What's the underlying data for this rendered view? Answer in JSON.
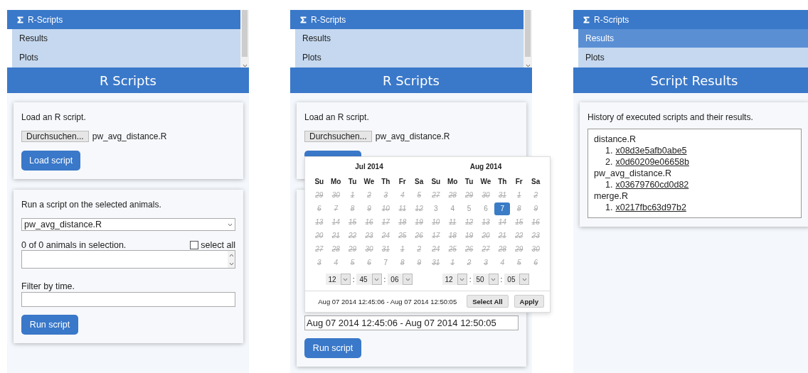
{
  "screens": [
    {
      "kind": "scripts",
      "menu": {
        "title": "R-Scripts",
        "items": [
          {
            "label": "Results",
            "selected": false
          },
          {
            "label": "Plots",
            "selected": false
          }
        ]
      },
      "title": "R Scripts",
      "load_card": {
        "text": "Load an R script.",
        "browse_button": "Durchsuchen...",
        "file_name": "pw_avg_distance.R",
        "load_button": "Load script"
      },
      "run_card": {
        "text": "Run a script on the selected animals.",
        "script_select": "pw_avg_distance.R",
        "selection_count": "0 of 0 animals in selection.",
        "select_all": {
          "label": "select all",
          "checked": false
        },
        "filter_label": "Filter by time.",
        "run_button": "Run script"
      }
    },
    {
      "kind": "scripts",
      "menu": {
        "title": "R-Scripts",
        "items": [
          {
            "label": "Results",
            "selected": false
          },
          {
            "label": "Plots",
            "selected": false
          }
        ]
      },
      "title": "R Scripts",
      "load_card": {
        "text": "Load an R script.",
        "browse_button": "Durchsuchen...",
        "file_name": "pw_avg_distance.R"
      },
      "run_card": {
        "filter_value": "Aug 07 2014 12:45:06 - Aug 07 2014 12:50:05",
        "run_button": "Run script"
      },
      "datepicker": {
        "months": [
          {
            "title": "Jul 2014",
            "weekdays": [
              "Su",
              "Mo",
              "Tu",
              "We",
              "Th",
              "Fr",
              "Sa"
            ],
            "weeks": [
              [
                {
                  "label": "29",
                  "disabled": true,
                  "selected": false
                },
                {
                  "label": "30",
                  "disabled": true,
                  "selected": false
                },
                {
                  "label": "1",
                  "disabled": true,
                  "selected": false
                },
                {
                  "label": "2",
                  "disabled": true,
                  "selected": false
                },
                {
                  "label": "3",
                  "disabled": true,
                  "selected": false
                },
                {
                  "label": "4",
                  "disabled": true,
                  "selected": false
                },
                {
                  "label": "5",
                  "disabled": true,
                  "selected": false
                }
              ],
              [
                {
                  "label": "6",
                  "disabled": true,
                  "selected": false
                },
                {
                  "label": "7",
                  "disabled": true,
                  "selected": false
                },
                {
                  "label": "8",
                  "disabled": true,
                  "selected": false
                },
                {
                  "label": "9",
                  "disabled": true,
                  "selected": false
                },
                {
                  "label": "10",
                  "disabled": true,
                  "selected": false
                },
                {
                  "label": "11",
                  "disabled": true,
                  "selected": false
                },
                {
                  "label": "12",
                  "disabled": true,
                  "selected": false
                }
              ],
              [
                {
                  "label": "13",
                  "disabled": true,
                  "selected": false
                },
                {
                  "label": "14",
                  "disabled": true,
                  "selected": false
                },
                {
                  "label": "15",
                  "disabled": true,
                  "selected": false
                },
                {
                  "label": "16",
                  "disabled": true,
                  "selected": false
                },
                {
                  "label": "17",
                  "disabled": true,
                  "selected": false
                },
                {
                  "label": "18",
                  "disabled": true,
                  "selected": false
                },
                {
                  "label": "19",
                  "disabled": true,
                  "selected": false
                }
              ],
              [
                {
                  "label": "20",
                  "disabled": true,
                  "selected": false
                },
                {
                  "label": "21",
                  "disabled": true,
                  "selected": false
                },
                {
                  "label": "22",
                  "disabled": true,
                  "selected": false
                },
                {
                  "label": "23",
                  "disabled": true,
                  "selected": false
                },
                {
                  "label": "24",
                  "disabled": true,
                  "selected": false
                },
                {
                  "label": "25",
                  "disabled": true,
                  "selected": false
                },
                {
                  "label": "26",
                  "disabled": true,
                  "selected": false
                }
              ],
              [
                {
                  "label": "27",
                  "disabled": true,
                  "selected": false
                },
                {
                  "label": "28",
                  "disabled": true,
                  "selected": false
                },
                {
                  "label": "29",
                  "disabled": true,
                  "selected": false
                },
                {
                  "label": "30",
                  "disabled": true,
                  "selected": false
                },
                {
                  "label": "31",
                  "disabled": true,
                  "selected": false
                },
                {
                  "label": "1",
                  "disabled": true,
                  "selected": false
                },
                {
                  "label": "2",
                  "disabled": true,
                  "selected": false
                }
              ],
              [
                {
                  "label": "3",
                  "disabled": true,
                  "selected": false
                },
                {
                  "label": "4",
                  "disabled": true,
                  "selected": false
                },
                {
                  "label": "5",
                  "disabled": true,
                  "selected": false
                },
                {
                  "label": "6",
                  "disabled": true,
                  "selected": false
                },
                {
                  "label": "7",
                  "disabled": false,
                  "selected": false
                },
                {
                  "label": "8",
                  "disabled": true,
                  "selected": false
                },
                {
                  "label": "9",
                  "disabled": true,
                  "selected": false
                }
              ]
            ],
            "time": [
              "12",
              "45",
              "06"
            ]
          },
          {
            "title": "Aug 2014",
            "weekdays": [
              "Su",
              "Mo",
              "Tu",
              "We",
              "Th",
              "Fr",
              "Sa"
            ],
            "weeks": [
              [
                {
                  "label": "27",
                  "disabled": true,
                  "selected": false
                },
                {
                  "label": "28",
                  "disabled": true,
                  "selected": false
                },
                {
                  "label": "29",
                  "disabled": true,
                  "selected": false
                },
                {
                  "label": "30",
                  "disabled": true,
                  "selected": false
                },
                {
                  "label": "31",
                  "disabled": true,
                  "selected": false
                },
                {
                  "label": "1",
                  "disabled": true,
                  "selected": false
                },
                {
                  "label": "2",
                  "disabled": true,
                  "selected": false
                }
              ],
              [
                {
                  "label": "3",
                  "disabled": false,
                  "selected": false
                },
                {
                  "label": "4",
                  "disabled": false,
                  "selected": false
                },
                {
                  "label": "5",
                  "disabled": false,
                  "selected": false
                },
                {
                  "label": "6",
                  "disabled": false,
                  "selected": false
                },
                {
                  "label": "7",
                  "disabled": false,
                  "selected": true
                },
                {
                  "label": "8",
                  "disabled": true,
                  "selected": false
                },
                {
                  "label": "9",
                  "disabled": true,
                  "selected": false
                }
              ],
              [
                {
                  "label": "10",
                  "disabled": true,
                  "selected": false
                },
                {
                  "label": "11",
                  "disabled": true,
                  "selected": false
                },
                {
                  "label": "12",
                  "disabled": true,
                  "selected": false
                },
                {
                  "label": "13",
                  "disabled": true,
                  "selected": false
                },
                {
                  "label": "14",
                  "disabled": true,
                  "selected": false
                },
                {
                  "label": "15",
                  "disabled": true,
                  "selected": false
                },
                {
                  "label": "16",
                  "disabled": true,
                  "selected": false
                }
              ],
              [
                {
                  "label": "17",
                  "disabled": true,
                  "selected": false
                },
                {
                  "label": "18",
                  "disabled": true,
                  "selected": false
                },
                {
                  "label": "19",
                  "disabled": true,
                  "selected": false
                },
                {
                  "label": "20",
                  "disabled": true,
                  "selected": false
                },
                {
                  "label": "21",
                  "disabled": true,
                  "selected": false
                },
                {
                  "label": "22",
                  "disabled": true,
                  "selected": false
                },
                {
                  "label": "23",
                  "disabled": true,
                  "selected": false
                }
              ],
              [
                {
                  "label": "24",
                  "disabled": true,
                  "selected": false
                },
                {
                  "label": "25",
                  "disabled": true,
                  "selected": false
                },
                {
                  "label": "26",
                  "disabled": true,
                  "selected": false
                },
                {
                  "label": "27",
                  "disabled": true,
                  "selected": false
                },
                {
                  "label": "28",
                  "disabled": true,
                  "selected": false
                },
                {
                  "label": "29",
                  "disabled": true,
                  "selected": false
                },
                {
                  "label": "30",
                  "disabled": true,
                  "selected": false
                }
              ],
              [
                {
                  "label": "31",
                  "disabled": true,
                  "selected": false
                },
                {
                  "label": "1",
                  "disabled": true,
                  "selected": false
                },
                {
                  "label": "2",
                  "disabled": true,
                  "selected": false
                },
                {
                  "label": "3",
                  "disabled": true,
                  "selected": false
                },
                {
                  "label": "4",
                  "disabled": true,
                  "selected": false
                },
                {
                  "label": "5",
                  "disabled": true,
                  "selected": false
                },
                {
                  "label": "6",
                  "disabled": true,
                  "selected": false
                }
              ]
            ],
            "time": [
              "12",
              "50",
              "05"
            ]
          }
        ],
        "time_separator": ":",
        "range": "Aug 07 2014 12:45:06 - Aug 07 2014 12:50:05",
        "select_all_button": "Select All",
        "apply_button": "Apply"
      }
    },
    {
      "kind": "results",
      "menu": {
        "title": "R-Scripts",
        "items": [
          {
            "label": "Results",
            "selected": true
          },
          {
            "label": "Plots",
            "selected": false
          }
        ]
      },
      "title": "Script Results",
      "history": {
        "text": "History of executed scripts and their results.",
        "items": [
          {
            "label": "distance.R",
            "children": [
              {
                "number": "1.",
                "label": "x08d3e5afb0abe5"
              },
              {
                "number": "2.",
                "label": "x0d60209e06658b"
              }
            ]
          },
          {
            "label": "pw_avg_distance.R",
            "children": [
              {
                "number": "1.",
                "label": "x03679760cd0d82"
              }
            ]
          },
          {
            "label": "merge.R",
            "children": [
              {
                "number": "1.",
                "label": "x0217fbc63d97b2"
              }
            ]
          }
        ]
      }
    }
  ]
}
